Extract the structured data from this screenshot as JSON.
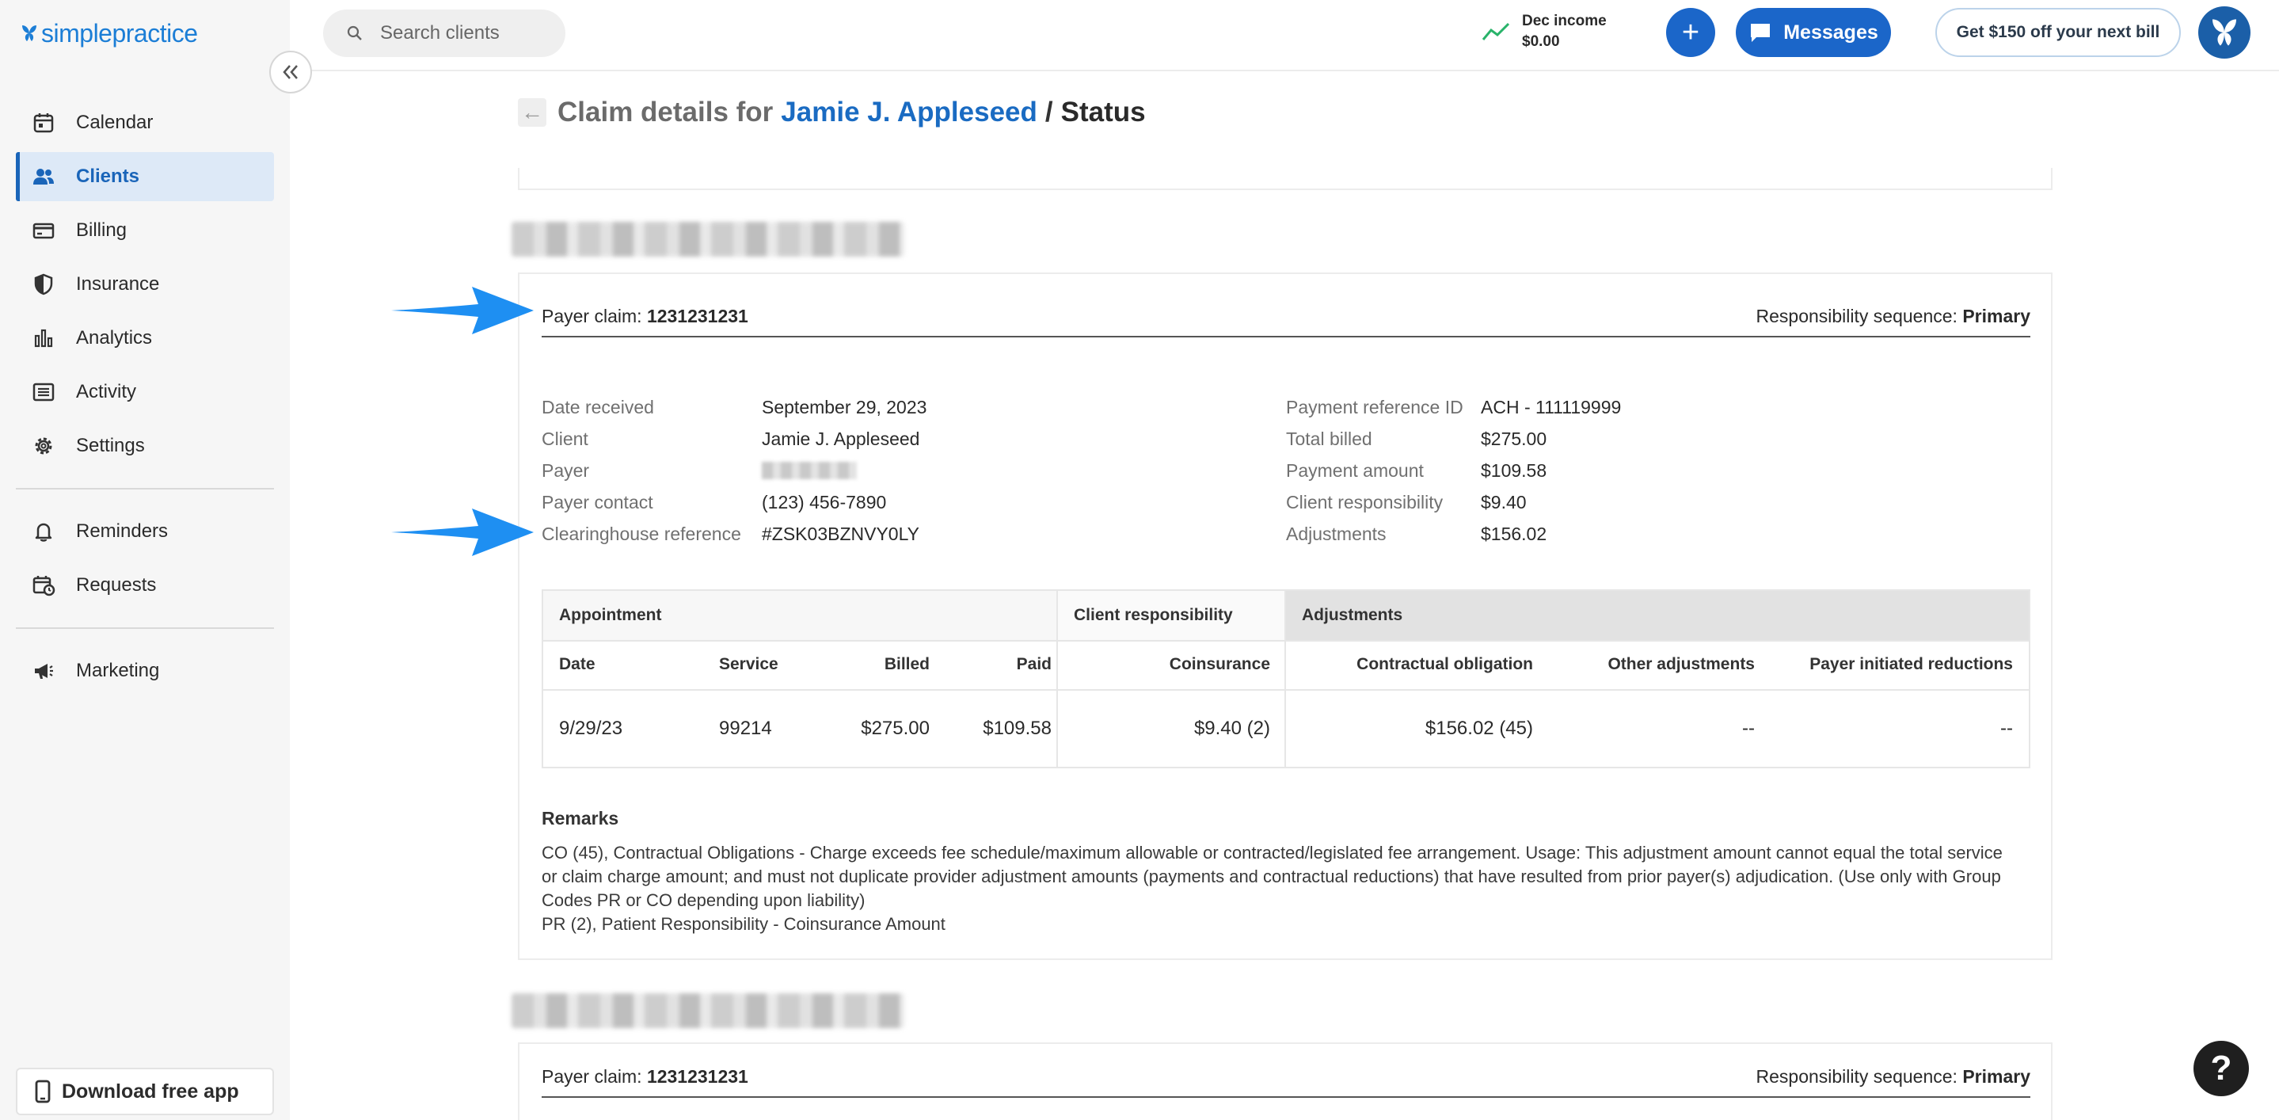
{
  "app": {
    "logo_text": "simplepractice",
    "collapse_icon": "double-chevron-left-icon"
  },
  "sidebar": {
    "items": [
      {
        "label": "Calendar",
        "icon": "calendar-icon",
        "active": false
      },
      {
        "label": "Clients",
        "icon": "users-icon",
        "active": true
      },
      {
        "label": "Billing",
        "icon": "credit-card-icon",
        "active": false
      },
      {
        "label": "Insurance",
        "icon": "shield-icon",
        "active": false
      },
      {
        "label": "Analytics",
        "icon": "bar-chart-icon",
        "active": false
      },
      {
        "label": "Activity",
        "icon": "list-icon",
        "active": false
      },
      {
        "label": "Settings",
        "icon": "gear-icon",
        "active": false
      },
      {
        "label": "Reminders",
        "icon": "bell-icon",
        "active": false
      },
      {
        "label": "Requests",
        "icon": "calendar-clock-icon",
        "active": false
      },
      {
        "label": "Marketing",
        "icon": "megaphone-icon",
        "active": false
      }
    ],
    "download_label": "Download free app"
  },
  "topbar": {
    "search_placeholder": "Search clients",
    "income_label": "Dec income",
    "income_value": "$0.00",
    "plus_label": "+",
    "messages_label": "Messages",
    "promo_label": "Get $150 off your next bill"
  },
  "page": {
    "title_prefix": "Claim details for",
    "client_name": "Jamie J. Appleseed",
    "separator": "/",
    "title_suffix": "Status"
  },
  "claims": [
    {
      "payer_claim_label": "Payer claim:",
      "payer_claim_number": "1231231231",
      "sequence_label": "Responsibility sequence:",
      "sequence_value": "Primary",
      "details_left": [
        {
          "label": "Date received",
          "value": "September 29, 2023"
        },
        {
          "label": "Client",
          "value": "Jamie J. Appleseed"
        },
        {
          "label": "Payer",
          "value": ""
        },
        {
          "label": "Payer contact",
          "value": "(123) 456-7890"
        },
        {
          "label": "Clearinghouse reference",
          "value": "#ZSK03BZNVY0LY"
        }
      ],
      "details_right": [
        {
          "label": "Payment reference ID",
          "value": "ACH - 111119999"
        },
        {
          "label": "Total billed",
          "value": "$275.00"
        },
        {
          "label": "Payment amount",
          "value": "$109.58"
        },
        {
          "label": "Client responsibility",
          "value": "$9.40"
        },
        {
          "label": "Adjustments",
          "value": "$156.02"
        }
      ],
      "table": {
        "groups": [
          "Appointment",
          "Client responsibility",
          "Adjustments"
        ],
        "headers": [
          "Date",
          "Service",
          "Billed",
          "Paid",
          "Coinsurance",
          "Contractual obligation",
          "Other adjustments",
          "Payer initiated reductions"
        ],
        "row": [
          "9/29/23",
          "99214",
          "$275.00",
          "$109.58",
          "$9.40 (2)",
          "$156.02 (45)",
          "--",
          "--"
        ]
      },
      "remarks_label": "Remarks",
      "remarks_lines": [
        "CO (45), Contractual Obligations - Charge exceeds fee schedule/maximum allowable or contracted/legislated fee arrangement. Usage: This adjustment amount cannot equal the total service or claim charge amount; and must not duplicate provider adjustment amounts (payments and contractual reductions) that have resulted from prior payer(s) adjudication. (Use only with Group Codes PR or CO depending upon liability)",
        "PR (2), Patient Responsibility - Coinsurance Amount"
      ]
    },
    {
      "payer_claim_label": "Payer claim:",
      "payer_claim_number": "1231231231",
      "sequence_label": "Responsibility sequence:",
      "sequence_value": "Primary"
    }
  ],
  "help_label": "?",
  "colors": {
    "accent": "#1b66c9",
    "annotation_arrow": "#1e8ff2",
    "active_nav_bg": "#dde9f7"
  }
}
